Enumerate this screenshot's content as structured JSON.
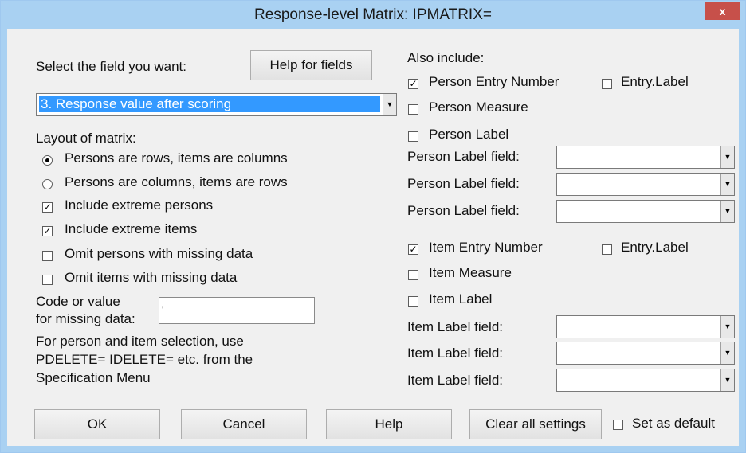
{
  "window": {
    "title": "Response-level Matrix: IPMATRIX=",
    "close_glyph": "x"
  },
  "field_section": {
    "prompt": "Select the field you want:",
    "help_button": "Help for fields",
    "selected_field": "3. Response value after scoring"
  },
  "layout": {
    "heading": "Layout of matrix:",
    "options": [
      {
        "label": "Persons are rows, items are columns",
        "selected": true
      },
      {
        "label": "Persons are columns, items are rows",
        "selected": false
      }
    ],
    "checkboxes": [
      {
        "label": "Include extreme persons",
        "checked": true
      },
      {
        "label": "Include extreme items",
        "checked": true
      },
      {
        "label": "Omit persons with missing data",
        "checked": false
      },
      {
        "label": "Omit items with missing data",
        "checked": false
      }
    ],
    "missing_code_label_line1": "Code or value",
    "missing_code_label_line2": "for missing data:",
    "missing_code_value": "'",
    "note_lines": [
      "For person and item selection, use",
      "PDELETE= IDELETE= etc. from the",
      "Specification Menu"
    ]
  },
  "also_include": {
    "heading": "Also include:",
    "person": {
      "entry_number": {
        "label": "Person Entry Number",
        "checked": true
      },
      "entry_label": {
        "label": "Entry.Label",
        "checked": false
      },
      "measure": {
        "label": "Person Measure",
        "checked": false
      },
      "label": {
        "label": "Person Label",
        "checked": false
      },
      "label_fields": [
        "Person Label field:",
        "Person Label field:",
        "Person Label field:"
      ]
    },
    "item": {
      "entry_number": {
        "label": "Item Entry Number",
        "checked": true
      },
      "entry_label": {
        "label": "Entry.Label",
        "checked": false
      },
      "measure": {
        "label": "Item Measure",
        "checked": false
      },
      "label": {
        "label": "Item Label",
        "checked": false
      },
      "label_fields": [
        "Item Label field:",
        "Item Label field:",
        "Item Label field:"
      ]
    }
  },
  "buttons": {
    "ok": "OK",
    "cancel": "Cancel",
    "help": "Help",
    "clear": "Clear all settings",
    "set_default": {
      "label": "Set as default",
      "checked": false
    }
  },
  "glyphs": {
    "check": "✓",
    "dropdown_arrow": "▼"
  }
}
